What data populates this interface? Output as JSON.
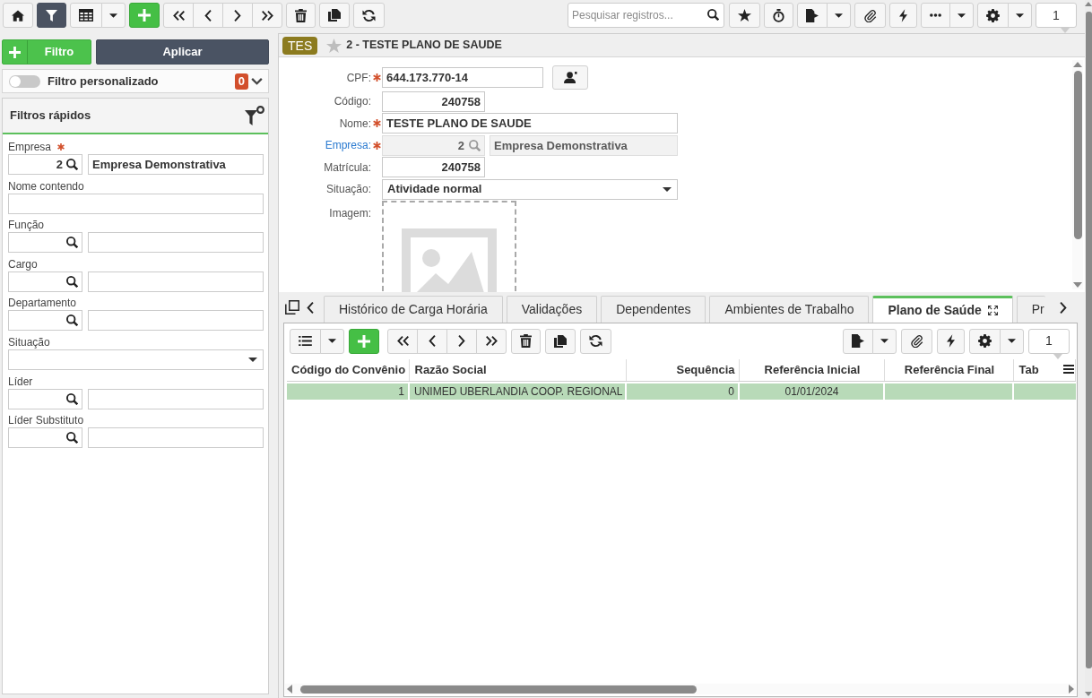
{
  "toolbar": {
    "filter_on": true,
    "search": {
      "placeholder": "Pesquisar registros..."
    },
    "page": "1"
  },
  "filter_panel": {
    "add_button": "Filtro",
    "apply_button": "Aplicar",
    "custom_filter": {
      "label": "Filtro personalizado",
      "on": false,
      "count": "0"
    },
    "quick_filters": {
      "title": "Filtros rápidos",
      "fields": [
        {
          "kind": "lookup",
          "label": "Empresa",
          "required": true,
          "code": "2",
          "description": "Empresa Demonstrativa"
        },
        {
          "kind": "text",
          "label": "Nome contendo",
          "required": false
        },
        {
          "kind": "lookup",
          "label": "Função",
          "required": false
        },
        {
          "kind": "lookup",
          "label": "Cargo",
          "required": false
        },
        {
          "kind": "lookup",
          "label": "Departamento",
          "required": false
        },
        {
          "kind": "select",
          "label": "Situação",
          "required": false
        },
        {
          "kind": "lookup",
          "label": "Líder",
          "required": false
        },
        {
          "kind": "lookup",
          "label": "Líder Substituto",
          "required": false
        }
      ]
    }
  },
  "record": {
    "badge": "TES",
    "favorite": false,
    "title": "2 - TESTE PLANO DE SAUDE",
    "fields": [
      {
        "kind": "text_action",
        "label": "CPF:",
        "required": true,
        "link": false,
        "disabled": false,
        "value": "644.173.770-14"
      },
      {
        "kind": "number",
        "label": "Código:",
        "required": false,
        "link": false,
        "disabled": false,
        "value": "240758"
      },
      {
        "kind": "text",
        "label": "Nome:",
        "required": true,
        "link": false,
        "disabled": false,
        "value": "TESTE PLANO DE SAUDE"
      },
      {
        "kind": "lookup",
        "label": "Empresa:",
        "required": true,
        "link": true,
        "disabled": true,
        "code": "2",
        "description": "Empresa Demonstrativa"
      },
      {
        "kind": "number",
        "label": "Matrícula:",
        "required": false,
        "link": false,
        "disabled": false,
        "value": "240758"
      },
      {
        "kind": "select",
        "label": "Situação:",
        "required": false,
        "link": false,
        "disabled": false,
        "value": "Atividade normal"
      },
      {
        "kind": "image",
        "label": "Imagem:",
        "required": false,
        "link": false,
        "disabled": false
      }
    ]
  },
  "tabs": [
    {
      "label": "Histórico de Carga Horária",
      "selected": false
    },
    {
      "label": "Validações",
      "selected": false
    },
    {
      "label": "Dependentes",
      "selected": false
    },
    {
      "label": "Ambientes de Trabalho",
      "selected": false
    },
    {
      "label": "Plano de Saúde",
      "selected": true
    },
    {
      "label": "Pr",
      "selected": false
    }
  ],
  "grid_toolbar": {
    "page": "1"
  },
  "table": {
    "columns": [
      "Código do Convênio",
      "Razão Social",
      "Sequência",
      "Referência Inicial",
      "Referência Final",
      "Tab"
    ],
    "rows": [
      {
        "selected": true,
        "cells": [
          "1",
          "UNIMED UBERLANDIA COOP. REGIONAL",
          "0",
          "01/01/2024",
          null,
          null
        ]
      }
    ]
  }
}
